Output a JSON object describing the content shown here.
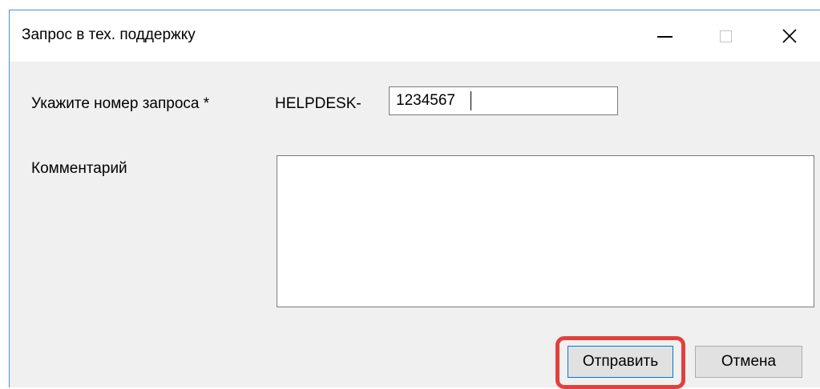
{
  "window": {
    "title": "Запрос в тех. поддержку",
    "controls": {
      "minimize_icon": "minimize-icon",
      "maximize_icon": "maximize-icon",
      "close_icon": "close-icon",
      "close_glyph": "✕"
    }
  },
  "form": {
    "request_label": "Укажите номер запроса *",
    "request_prefix": "HELPDESK-",
    "request_value": "1234567",
    "comment_label": "Комментарий",
    "comment_value": ""
  },
  "buttons": {
    "submit_label": "Отправить",
    "cancel_label": "Отмена"
  },
  "colors": {
    "highlight": "#e0413b",
    "window_border": "#4f8fd3",
    "focus_border": "#0078d7"
  }
}
